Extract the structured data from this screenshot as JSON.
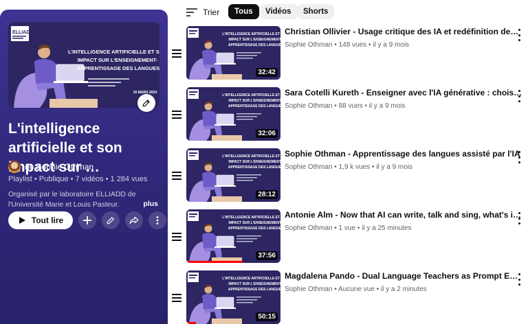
{
  "playlist": {
    "cover": {
      "logo_text": "ELLIADD",
      "heading": "L'INTELLIGENCE ARTIFICIELLE ET SON IMPACT SUR L'ENSEIGNEMENT-APPRENTISSAGE DES LANGUES",
      "date": "25 MARS 2024"
    },
    "title": "L'intelligence artificielle et son impact sur …",
    "owner": "de Sophie Othman",
    "meta": "Playlist • Publique • 7 vidéos • 1 284 vues",
    "description": "Organisé par le laboratoire ELLIADD de l'Université Marie et Louis Pasteur. Coordination : Sophie Othman & C...",
    "more_label": "plus",
    "play_all_label": "Tout lire",
    "icons": [
      "edit-icon",
      "play-icon",
      "add-icon",
      "pencil-icon",
      "share-icon",
      "more-vert-icon"
    ]
  },
  "filters": {
    "sort_label": "Trier",
    "chips": [
      {
        "label": "Tous",
        "active": true
      },
      {
        "label": "Vidéos",
        "active": false
      },
      {
        "label": "Shorts",
        "active": false
      }
    ]
  },
  "videos": [
    {
      "title": "Christian Ollivier - Usage critique des IA et redéfinition des…",
      "channel": "Sophie Othman",
      "views": "148 vues",
      "age": "il y a 9 mois",
      "duration": "32:42",
      "watched": 0
    },
    {
      "title": "Sara Cotelli Kureth - Enseigner avec l'IA générative : choisir des tâch…",
      "channel": "Sophie Othman",
      "views": "88 vues",
      "age": "il y a 9 mois",
      "duration": "32:06",
      "watched": 0
    },
    {
      "title": "Sophie Othman - Apprentissage des langues assisté par l'IA",
      "channel": "Sophie Othman",
      "views": "1,9 k vues",
      "age": "il y a 9 mois",
      "duration": "28:12",
      "watched": 0
    },
    {
      "title": "Antonie Alm - Now that AI can write, talk and sing, what's in it for the…",
      "channel": "Sophie Othman",
      "views": "1 vue",
      "age": "il y a 25 minutes",
      "duration": "37:56",
      "watched": 0.6
    },
    {
      "title": "Magdalena Pando - Dual Language Teachers as Prompt Engineers",
      "channel": "Sophie Othman",
      "views": "Aucune vue",
      "age": "il y a 2 minutes",
      "duration": "50:15",
      "watched": 0.1
    }
  ],
  "meta_separator": "•",
  "colors": {
    "panel_top": "#3e3392",
    "panel_bottom": "#28226a",
    "thumb_bg": "#2d2663",
    "progress": "#ff0000",
    "chip_active": "#0f0f0f",
    "chip_inactive": "#f0f0f0"
  }
}
